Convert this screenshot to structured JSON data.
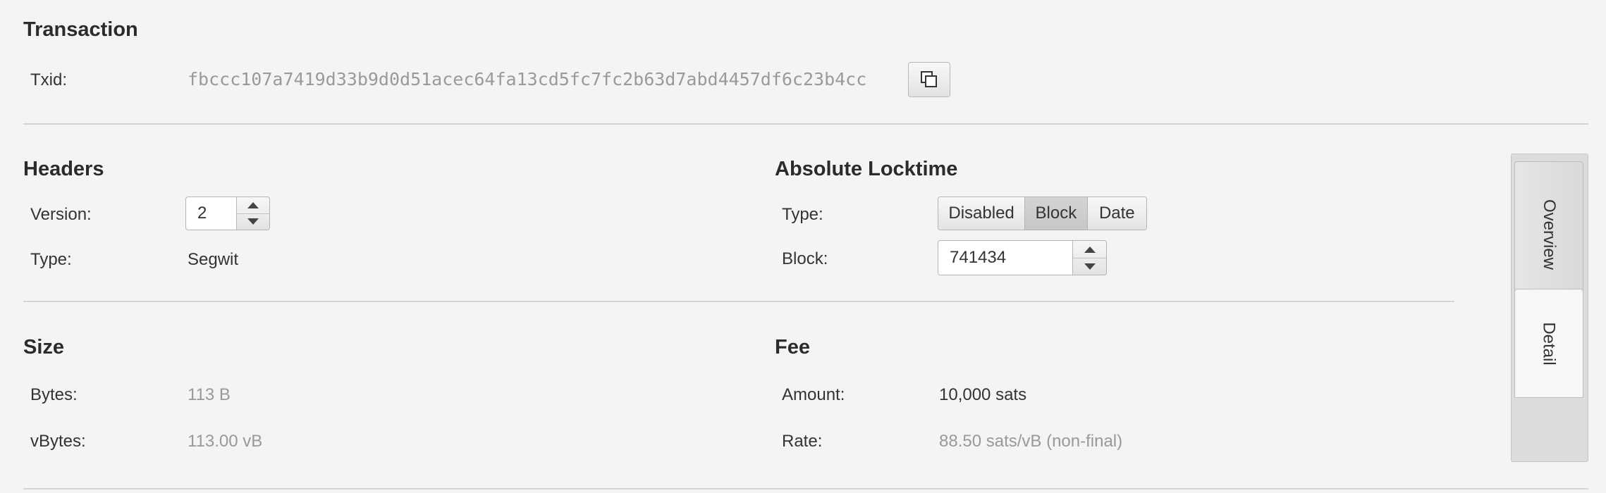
{
  "transaction": {
    "title": "Transaction",
    "txid_label": "Txid:",
    "txid_value": "fbccc107a7419d33b9d0d51acec64fa13cd5fc7fc2b63d7abd4457df6c23b4cc"
  },
  "headers": {
    "title": "Headers",
    "version_label": "Version:",
    "version_value": "2",
    "type_label": "Type:",
    "type_value": "Segwit"
  },
  "locktime": {
    "title": "Absolute Locktime",
    "type_label": "Type:",
    "options": [
      "Disabled",
      "Block",
      "Date"
    ],
    "selected": "Block",
    "block_label": "Block:",
    "block_value": "741434"
  },
  "size": {
    "title": "Size",
    "bytes_label": "Bytes:",
    "bytes_value": "113 B",
    "vbytes_label": "vBytes:",
    "vbytes_value": "113.00 vB"
  },
  "fee": {
    "title": "Fee",
    "amount_label": "Amount:",
    "amount_value": "10,000 sats",
    "rate_label": "Rate:",
    "rate_value": "88.50 sats/vB (non-final)"
  },
  "tabs": {
    "overview": "Overview",
    "detail": "Detail",
    "active": "Detail"
  }
}
